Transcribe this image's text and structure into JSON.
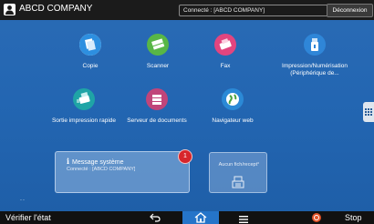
{
  "topbar": {
    "company": "ABCD COMPANY",
    "connection_status": "Connecté : [ABCD COMPANY]",
    "logout_label": "Déconnexion"
  },
  "apps": [
    {
      "id": "copy",
      "label": "Copie",
      "color": "#2d8fe0",
      "icon": "copy-icon"
    },
    {
      "id": "scanner",
      "label": "Scanner",
      "color": "#58b646",
      "icon": "scanner-icon"
    },
    {
      "id": "fax",
      "label": "Fax",
      "color": "#e2457f",
      "icon": "fax-icon"
    },
    {
      "id": "print-scan",
      "label": "Impression/Numérisation",
      "label2": "(Périphérique de...",
      "color": "#2f86d8",
      "icon": "usb-memory-icon"
    },
    {
      "id": "quick-print",
      "label": "Sortie impression rapide",
      "color": "#1fa4a6",
      "icon": "quick-print-icon"
    },
    {
      "id": "doc-server",
      "label": "Serveur de documents",
      "color": "#c0457a",
      "icon": "document-server-icon"
    },
    {
      "id": "web-browser",
      "label": "Navigateur web",
      "color": "#2b89d6",
      "icon": "globe-icon"
    }
  ],
  "message_widget": {
    "title": "Message système",
    "subtitle": "Connecté : [ABCD COMPANY]",
    "badge_count": "1"
  },
  "receipt_widget": {
    "text": "Aucun fich/recept°"
  },
  "page_indicator": "..",
  "bottombar": {
    "check_status_label": "Vérifier l'état",
    "stop_label": "Stop"
  }
}
